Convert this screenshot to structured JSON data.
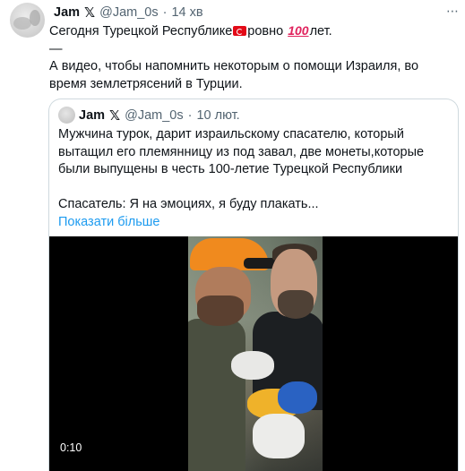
{
  "tweet": {
    "name": "Jam",
    "badge": "𝕏",
    "handle": "@Jam_0s",
    "separator": "·",
    "time": "14 хв",
    "more": "⋯",
    "text_line1_part1": "Сегодня Турецкой Республике",
    "text_line1_part2": "ровно",
    "text_line1_emoji": "100",
    "text_line1_part3": "лет.",
    "text_dash": "—",
    "text_body": "А видео, чтобы напомнить некоторым о помощи Израиля, во время землетрясений в Турции."
  },
  "quoted": {
    "name": "Jam",
    "badge": "𝕏",
    "handle": "@Jam_0s",
    "separator": "·",
    "time": "10 лют.",
    "text": "Мужчина турок, дарит израильскому спасателю, который вытащил его племянницу из под завал, две монеты,которые были выпущены в честь 100-летие Турецкой Республики",
    "text2": "Спасатель: Я на эмоциях, я буду плакать...",
    "show_more": "Показати більше",
    "video_duration": "0:10"
  },
  "colors": {
    "accent": "#1d9bf0",
    "secondary_text": "#536471",
    "border": "#cfd9de",
    "flag_red": "#e30a17",
    "hundred_red": "#e0245e"
  }
}
